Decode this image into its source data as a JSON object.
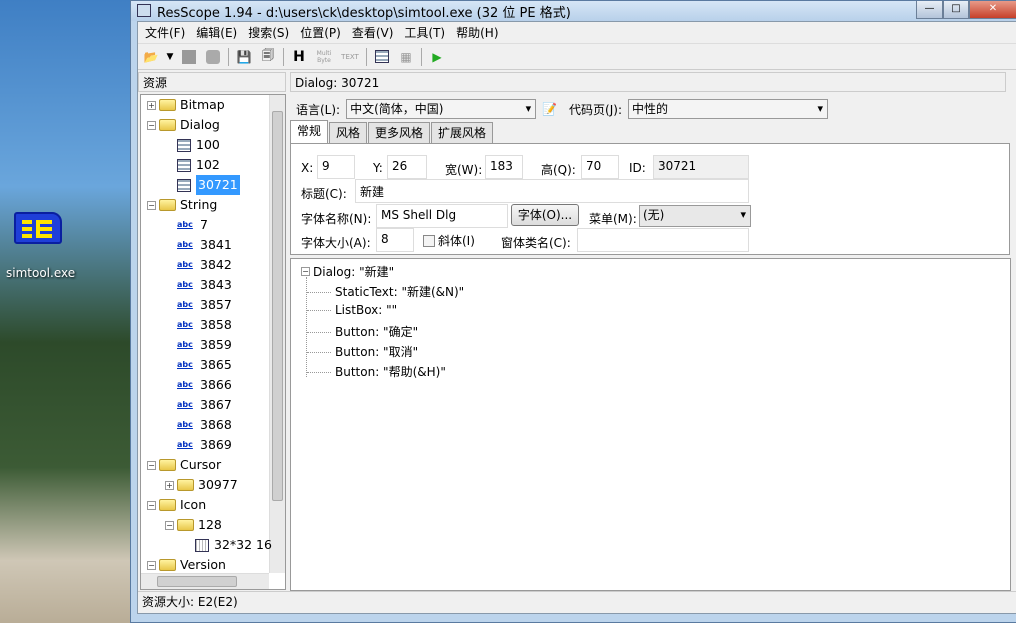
{
  "desktop": {
    "icon_label": "simtool.exe"
  },
  "window": {
    "title": "ResScope 1.94 - d:\\users\\ck\\desktop\\simtool.exe (32 位 PE 格式)"
  },
  "menu": [
    "文件(F)",
    "编辑(E)",
    "搜索(S)",
    "位置(P)",
    "查看(V)",
    "工具(T)",
    "帮助(H)"
  ],
  "toolbar": {
    "h": "H",
    "multibyte": "Multi Byte",
    "text": "TEXT"
  },
  "left": {
    "header": "资源",
    "tree": [
      {
        "label": "Bitmap",
        "level": 0,
        "type": "folder",
        "exp": "+"
      },
      {
        "label": "Dialog",
        "level": 0,
        "type": "folder",
        "exp": "-"
      },
      {
        "label": "100",
        "level": 1,
        "type": "dialog"
      },
      {
        "label": "102",
        "level": 1,
        "type": "dialog"
      },
      {
        "label": "30721",
        "level": 1,
        "type": "dialog",
        "selected": true
      },
      {
        "label": "String",
        "level": 0,
        "type": "folder",
        "exp": "-"
      },
      {
        "label": "7",
        "level": 1,
        "type": "string"
      },
      {
        "label": "3841",
        "level": 1,
        "type": "string"
      },
      {
        "label": "3842",
        "level": 1,
        "type": "string"
      },
      {
        "label": "3843",
        "level": 1,
        "type": "string"
      },
      {
        "label": "3857",
        "level": 1,
        "type": "string"
      },
      {
        "label": "3858",
        "level": 1,
        "type": "string"
      },
      {
        "label": "3859",
        "level": 1,
        "type": "string"
      },
      {
        "label": "3865",
        "level": 1,
        "type": "string"
      },
      {
        "label": "3866",
        "level": 1,
        "type": "string"
      },
      {
        "label": "3867",
        "level": 1,
        "type": "string"
      },
      {
        "label": "3868",
        "level": 1,
        "type": "string"
      },
      {
        "label": "3869",
        "level": 1,
        "type": "string"
      },
      {
        "label": "Cursor",
        "level": 0,
        "type": "folder",
        "exp": "-"
      },
      {
        "label": "30977",
        "level": 1,
        "type": "folder",
        "exp": "+"
      },
      {
        "label": "Icon",
        "level": 0,
        "type": "folder",
        "exp": "-"
      },
      {
        "label": "128",
        "level": 1,
        "type": "folder",
        "exp": "-"
      },
      {
        "label": "32*32 16",
        "level": 2,
        "type": "image"
      },
      {
        "label": "Version",
        "level": 0,
        "type": "folder",
        "exp": "-"
      }
    ],
    "abc": "abc"
  },
  "right": {
    "header": "Dialog: 30721",
    "language_label": "语言(L):",
    "language_value": "中文(简体，中国)",
    "codepage_label": "代码页(J):",
    "codepage_value": "中性的",
    "tabs": [
      "常规",
      "风格",
      "更多风格",
      "扩展风格"
    ],
    "form": {
      "x_label": "X:",
      "x": "9",
      "y_label": "Y:",
      "y": "26",
      "w_label": "宽(W):",
      "w": "183",
      "h_label": "高(Q):",
      "h": "70",
      "id_label": "ID:",
      "id": "30721",
      "caption_label": "标题(C):",
      "caption": "新建",
      "font_label": "字体名称(N):",
      "font": "MS Shell Dlg",
      "font_button": "字体(O)...",
      "menu_label": "菜单(M):",
      "menu_value": "(无)",
      "size_label": "字体大小(A):",
      "size": "8",
      "italic_label": "斜体(I)",
      "class_label": "窗体类名(C):",
      "class_value": ""
    },
    "controls": {
      "root": "Dialog: \"新建\"",
      "children": [
        "StaticText: \"新建(&N)\"",
        "ListBox: \"\"",
        "Button: \"确定\"",
        "Button: \"取消\"",
        "Button: \"帮助(&H)\""
      ]
    }
  },
  "status": "资源大小: E2(E2)"
}
